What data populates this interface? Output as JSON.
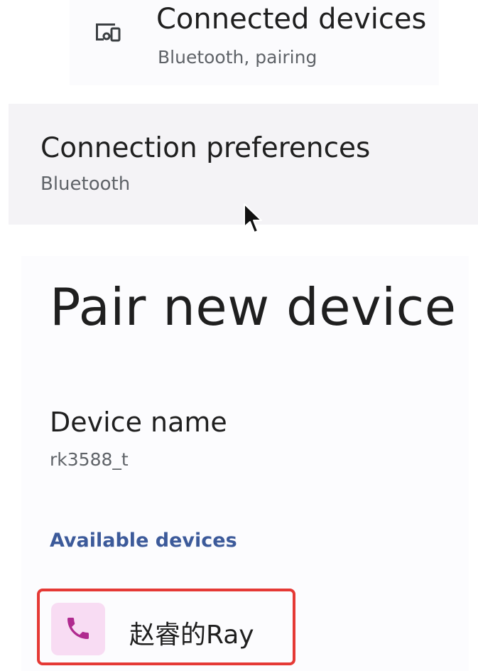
{
  "connected_devices": {
    "title": "Connected devices",
    "subtitle": "Bluetooth, pairing",
    "icon": "connected-devices-icon"
  },
  "connection_preferences": {
    "title": "Connection preferences",
    "subtitle": "Bluetooth"
  },
  "pair_new_device": {
    "title": "Pair new device",
    "device_name_label": "Device name",
    "device_name_value": "rk3588_t",
    "available_devices_label": "Available devices",
    "devices": [
      {
        "name": "赵睿的Ray",
        "icon": "phone-icon"
      }
    ]
  },
  "colors": {
    "accent_label": "#3c5a9a",
    "highlight_border": "#e53935",
    "device_icon_bg": "#f8dcf3",
    "device_icon_fg": "#b02a8f"
  }
}
